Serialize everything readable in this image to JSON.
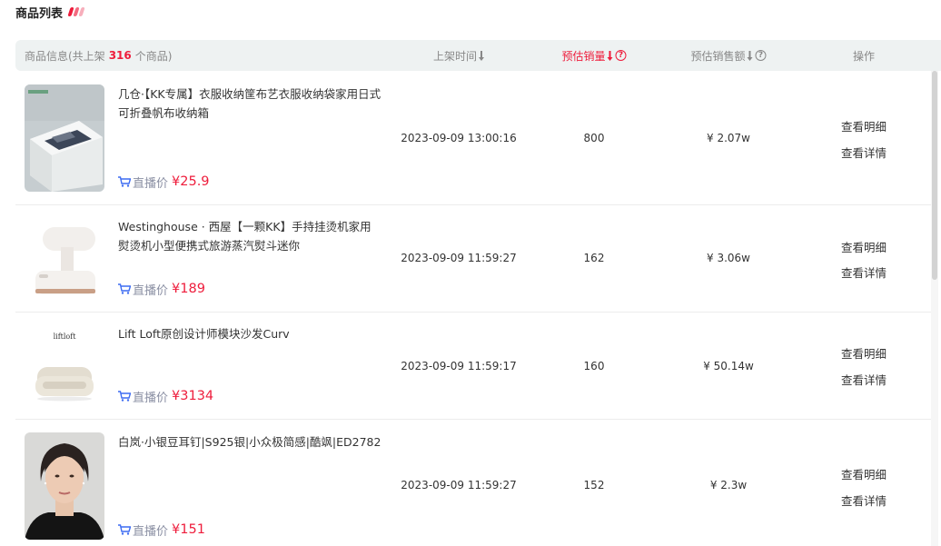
{
  "page": {
    "title": "商品列表",
    "deco_colors": [
      "#ee1d3c",
      "#f36a80",
      "#f7aebb"
    ]
  },
  "header": {
    "info_prefix": "商品信息(共上架",
    "info_count": "316",
    "info_suffix": "个商品)",
    "listed_time": "上架时间",
    "est_sales": "预估销量",
    "est_revenue": "预估销售额",
    "operation": "操作",
    "sort_icon": "sort-desc-icon",
    "help_icon": "question-circle-icon",
    "help_glyph": "?"
  },
  "accent_color": "#ee1d3c",
  "price_label_color": "#8a8fa3",
  "products": [
    {
      "name": "几仓·【KK专属】衣服收纳筐布艺衣服收纳袋家用日式可折叠帆布收纳箱",
      "price_label": "直播价",
      "price": "¥25.9",
      "listed_time": "2023-09-09 13:00:16",
      "sales": "800",
      "revenue": "¥ 2.07w",
      "detail_label": "查看明细",
      "info_label": "查看详情",
      "image_icon": "storage-box-thumbnail"
    },
    {
      "name": "Westinghouse · 西屋【一颗KK】手持挂烫机家用熨烫机小型便携式旅游蒸汽熨斗迷你",
      "price_label": "直播价",
      "price": "¥189",
      "listed_time": "2023-09-09 11:59:27",
      "sales": "162",
      "revenue": "¥ 3.06w",
      "detail_label": "查看明细",
      "info_label": "查看详情",
      "image_icon": "garment-steamer-thumbnail"
    },
    {
      "name": "Lift Loft原创设计师模块沙发Curv",
      "price_label": "直播价",
      "price": "¥3134",
      "listed_time": "2023-09-09 11:59:17",
      "sales": "160",
      "revenue": "¥ 50.14w",
      "detail_label": "查看明细",
      "info_label": "查看详情",
      "image_icon": "sofa-thumbnail",
      "image_brand": "liftloft"
    },
    {
      "name": "白岚·小银豆耳钉|S925银|小众极简感|酷飒|ED2782",
      "price_label": "直播价",
      "price": "¥151",
      "listed_time": "2023-09-09 11:59:27",
      "sales": "152",
      "revenue": "¥ 2.3w",
      "detail_label": "查看明细",
      "info_label": "查看详情",
      "image_icon": "model-portrait-thumbnail"
    }
  ]
}
